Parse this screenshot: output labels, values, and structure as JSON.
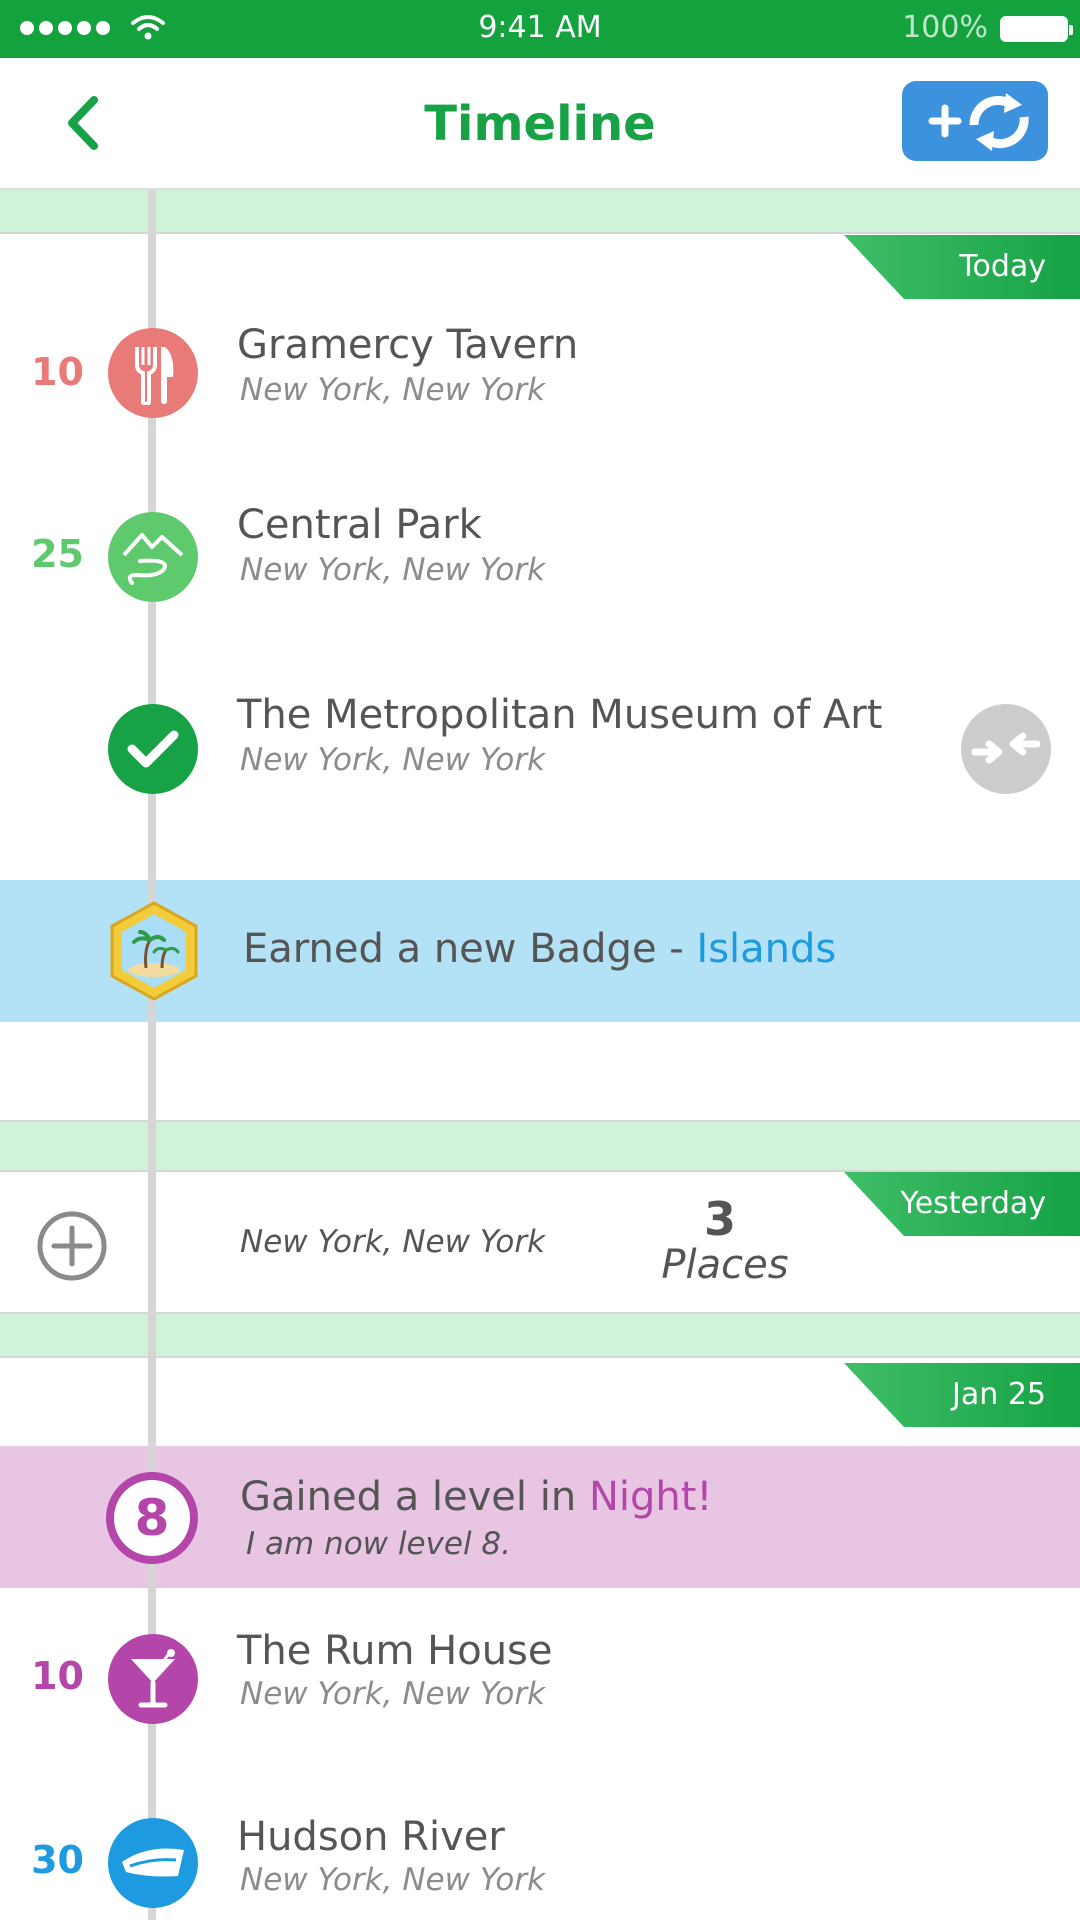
{
  "status_bar": {
    "time": "9:41 AM",
    "battery": "100%"
  },
  "header": {
    "title": "Timeline"
  },
  "colors": {
    "brand_green": "#16a245",
    "accent_blue": "#3d92de",
    "badge_blue": "#1e9be0",
    "level_purple": "#b346a8",
    "red": "#e87a78"
  },
  "sections": {
    "today": {
      "label": "Today",
      "items": [
        {
          "points": "10",
          "name": "Gramercy Tavern",
          "location": "New York, New York",
          "icon": "fork-knife-icon"
        },
        {
          "points": "25",
          "name": "Central Park",
          "location": "New York, New York",
          "icon": "park-mountain-icon"
        },
        {
          "points": "",
          "name": "The Metropolitan Museum of Art",
          "location": "New York, New York",
          "icon": "checkmark-icon"
        }
      ],
      "badge": {
        "text": "Earned a new Badge - ",
        "highlight": "Islands",
        "icon": "island-badge-icon"
      }
    },
    "yesterday": {
      "label": "Yesterday",
      "location": "New York, New York",
      "count": "3",
      "count_label": "Places"
    },
    "jan25": {
      "label": "Jan 25",
      "level": {
        "number": "8",
        "text": "Gained a level in ",
        "highlight": "Night!",
        "sub": "I am now level 8."
      },
      "items": [
        {
          "points": "10",
          "name": "The Rum House",
          "location": "New York, New York",
          "icon": "cocktail-icon"
        },
        {
          "points": "30",
          "name": "Hudson River",
          "location": "New York, New York",
          "icon": "boat-icon"
        }
      ]
    }
  }
}
